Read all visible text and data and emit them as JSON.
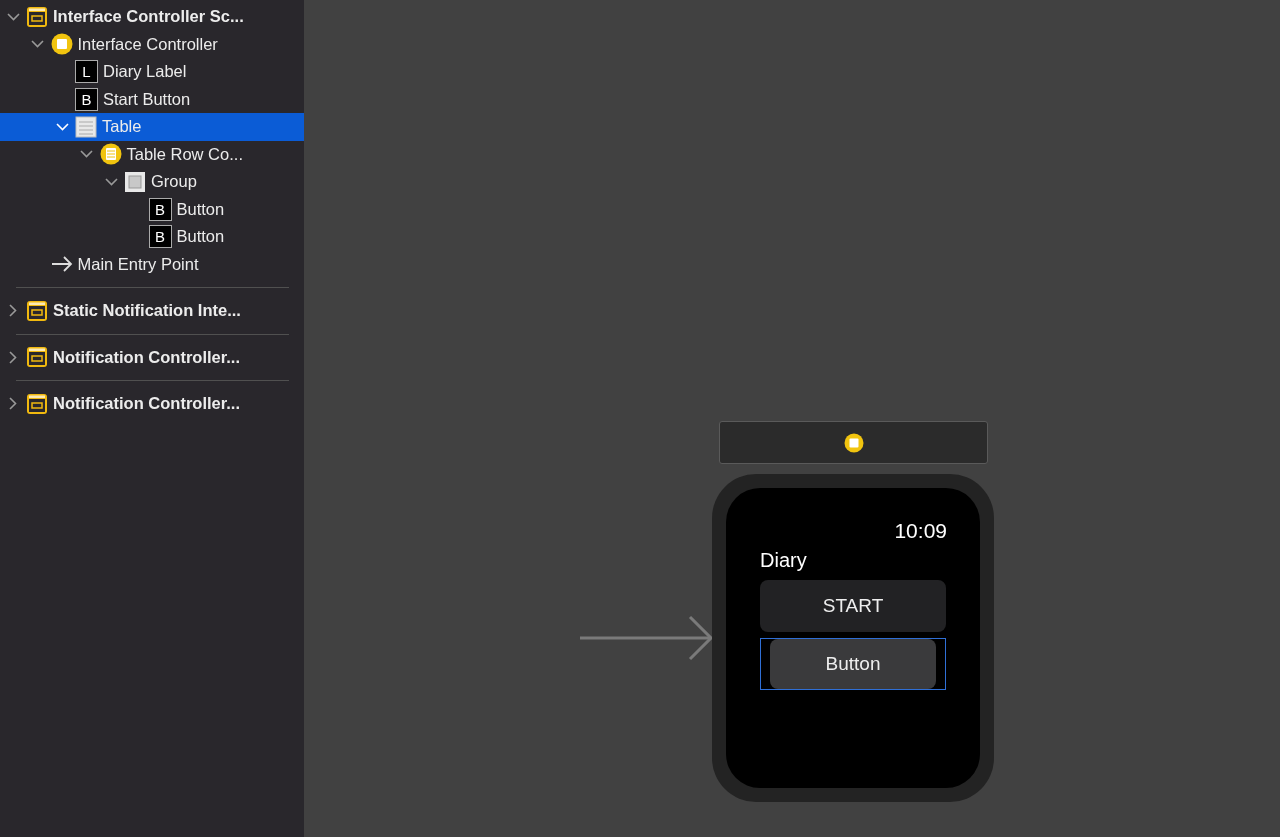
{
  "outline": [
    {
      "kind": "scene",
      "label": "Interface Controller Sc...",
      "expanded": true,
      "selected": false,
      "children": [
        {
          "kind": "controller",
          "label": "Interface Controller",
          "expanded": true,
          "selected": false,
          "children": [
            {
              "kind": "label",
              "glyph": "L",
              "label": "Diary Label",
              "selected": false
            },
            {
              "kind": "button",
              "glyph": "B",
              "label": "Start Button",
              "selected": false
            },
            {
              "kind": "table",
              "label": "Table",
              "expanded": true,
              "selected": true,
              "children": [
                {
                  "kind": "row",
                  "label": "Table Row Co...",
                  "expanded": true,
                  "selected": false,
                  "children": [
                    {
                      "kind": "group",
                      "label": "Group",
                      "expanded": true,
                      "selected": false,
                      "children": [
                        {
                          "kind": "button",
                          "glyph": "B",
                          "label": "Button",
                          "selected": false
                        },
                        {
                          "kind": "button",
                          "glyph": "B",
                          "label": "Button",
                          "selected": false
                        }
                      ]
                    }
                  ]
                }
              ]
            }
          ]
        },
        {
          "kind": "entry",
          "label": "Main Entry Point",
          "selected": false
        }
      ]
    },
    {
      "kind": "scene",
      "label": "Static Notification Inte...",
      "expanded": false,
      "selected": false
    },
    {
      "kind": "scene",
      "label": "Notification Controller...",
      "expanded": false,
      "selected": false
    },
    {
      "kind": "scene",
      "label": "Notification Controller...",
      "expanded": false,
      "selected": false
    }
  ],
  "watch": {
    "time": "10:09",
    "title": "Diary",
    "buttons": [
      {
        "label": "START",
        "selected": false
      },
      {
        "label": "Button",
        "selected": true
      }
    ]
  }
}
